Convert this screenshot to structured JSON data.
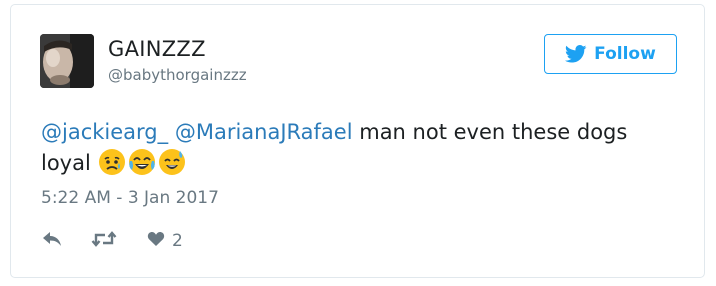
{
  "author": {
    "display_name": "GAINZZZ",
    "screen_name": "@babythorgainzzz",
    "avatar": "profile-photo"
  },
  "follow_button": {
    "label": "Follow",
    "icon": "twitter-bird-icon",
    "color": "#1da1f2"
  },
  "tweet": {
    "mentions": [
      "@jackiearg_",
      "@MarianaJRafael"
    ],
    "text": "man not even these dogs loyal",
    "emojis": [
      "disappointed-but-relieved-face",
      "face-with-tears-of-joy",
      "smiling-face-with-open-mouth-and-cold-sweat"
    ],
    "timestamp": "5:22 AM - 3 Jan 2017",
    "mention_color": "#2b7bb9"
  },
  "actions": {
    "reply_icon": "reply-icon",
    "retweet_icon": "retweet-icon",
    "like_icon": "heart-icon",
    "like_count": "2"
  }
}
